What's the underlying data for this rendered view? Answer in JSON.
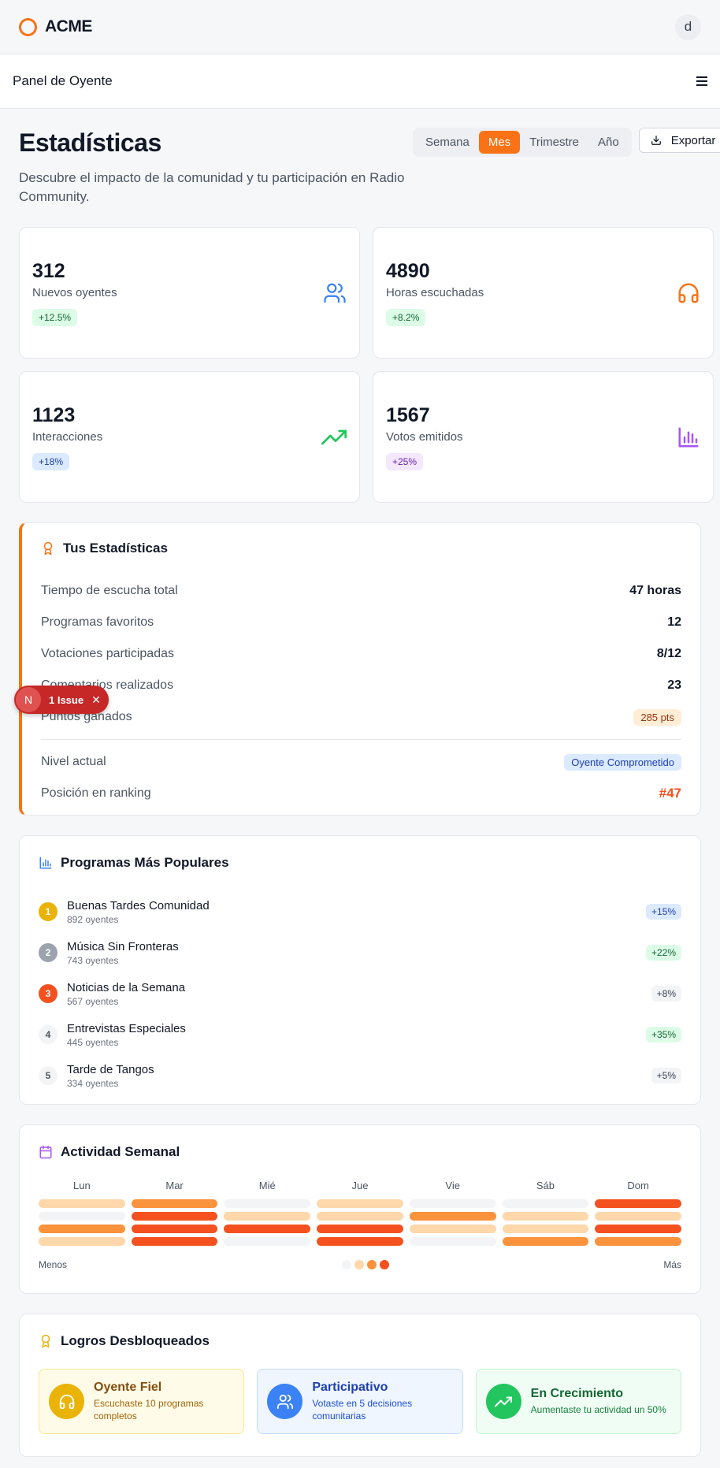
{
  "app": {
    "brand": "ACME",
    "user_initial": "d",
    "section_title": "Panel de Oyente"
  },
  "header": {
    "title": "Estadísticas",
    "subtitle": "Descubre el impacto de la comunidad y tu participación en Radio Community.",
    "periods": [
      "Semana",
      "Mes",
      "Trimestre",
      "Año"
    ],
    "active_period": "Mes",
    "export_label": "Exportar"
  },
  "stats": [
    {
      "value": "312",
      "label": "Nuevos oyentes",
      "badge": "+12.5%",
      "icon": "users-icon",
      "color": "#3b82f6"
    },
    {
      "value": "4890",
      "label": "Horas escuchadas",
      "badge": "+8.2%",
      "icon": "headphones-icon",
      "color": "#f97316"
    },
    {
      "value": "1123",
      "label": "Interacciones",
      "badge": "+18%",
      "icon": "trending-up-icon",
      "color": "#22c55e"
    },
    {
      "value": "1567",
      "label": "Votos emitidos",
      "badge": "+25%",
      "icon": "bar-chart-icon",
      "color": "#a855f7"
    }
  ],
  "my_stats": {
    "title": "Tus Estadísticas",
    "rows": [
      {
        "label": "Tiempo de escucha total",
        "value": "47 horas"
      },
      {
        "label": "Programas favoritos",
        "value": "12"
      },
      {
        "label": "Votaciones participadas",
        "value": "8/12"
      },
      {
        "label": "Comentarios realizados",
        "value": "23"
      },
      {
        "label": "Puntos ganados",
        "value": "285 pts"
      }
    ],
    "level_label": "Nivel actual",
    "level_value": "Oyente Comprometido",
    "ranking_label": "Posición en ranking",
    "ranking_value": "#47"
  },
  "popular": {
    "title": "Programas Más Populares",
    "items": [
      {
        "rank": "1",
        "name": "Buenas Tardes Comunidad",
        "listeners": "892 oyentes",
        "trend": "+15%"
      },
      {
        "rank": "2",
        "name": "Música Sin Fronteras",
        "listeners": "743 oyentes",
        "trend": "+22%"
      },
      {
        "rank": "3",
        "name": "Noticias de la Semana",
        "listeners": "567 oyentes",
        "trend": "+8%"
      },
      {
        "rank": "4",
        "name": "Entrevistas Especiales",
        "listeners": "445 oyentes",
        "trend": "+35%"
      },
      {
        "rank": "5",
        "name": "Tarde de Tangos",
        "listeners": "334 oyentes",
        "trend": "+5%"
      }
    ]
  },
  "weekly": {
    "title": "Actividad Semanal",
    "days": [
      "Lun",
      "Mar",
      "Mié",
      "Jue",
      "Vie",
      "Sáb",
      "Dom"
    ],
    "levels": [
      [
        1,
        2,
        0,
        1,
        0,
        0,
        3
      ],
      [
        0,
        3,
        1,
        1,
        2,
        1,
        1
      ],
      [
        2,
        3,
        3,
        3,
        1,
        1,
        3
      ],
      [
        1,
        3,
        0,
        3,
        0,
        2,
        2
      ]
    ],
    "palette": [
      "#f3f4f6",
      "#fed7aa",
      "#fb923c",
      "#f4511e"
    ],
    "less_label": "Menos",
    "more_label": "Más"
  },
  "achievements": {
    "title": "Logros Desbloqueados",
    "items": [
      {
        "title": "Oyente Fiel",
        "desc": "Escuchaste 10 programas completos",
        "icon": "headphones-icon"
      },
      {
        "title": "Participativo",
        "desc": "Votaste en 5 decisiones comunitarias",
        "icon": "users-icon"
      },
      {
        "title": "En Crecimiento",
        "desc": "Aumentaste tu actividad un 50%",
        "icon": "trending-up-icon"
      }
    ]
  },
  "overlay": {
    "initial": "N",
    "issues_label": "1 Issue"
  }
}
